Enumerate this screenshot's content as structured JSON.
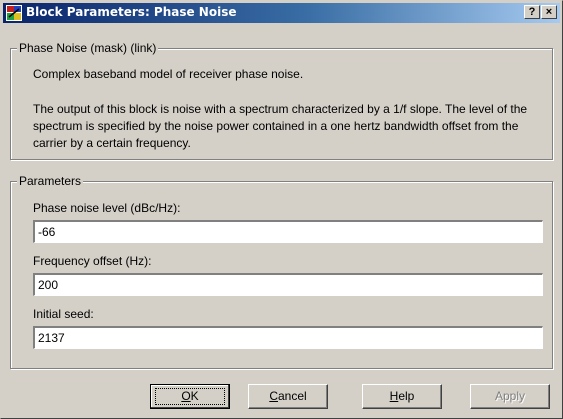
{
  "window": {
    "title": "Block Parameters: Phase Noise",
    "help_button": "?",
    "close_button": "×"
  },
  "mask": {
    "legend": "Phase Noise (mask) (link)",
    "summary": "Complex baseband model of receiver phase noise.",
    "description": "The output of this block is noise with a spectrum characterized by a 1/f slope.  The level of the spectrum is specified by the noise power contained in a one hertz bandwidth offset from the carrier by a certain frequency."
  },
  "parameters": {
    "legend": "Parameters",
    "phase_noise_label": "Phase noise level (dBc/Hz):",
    "phase_noise_value": "-66",
    "freq_offset_label": "Frequency offset (Hz):",
    "freq_offset_value": "200",
    "seed_label": "Initial seed:",
    "seed_value": "2137"
  },
  "buttons": {
    "ok_first": "O",
    "ok_rest": "K",
    "cancel_first": "C",
    "cancel_rest": "ancel",
    "help_first": "H",
    "help_rest": "elp",
    "apply_label": "Apply"
  },
  "icons": {
    "window_icon": "simulink-block-icon"
  }
}
